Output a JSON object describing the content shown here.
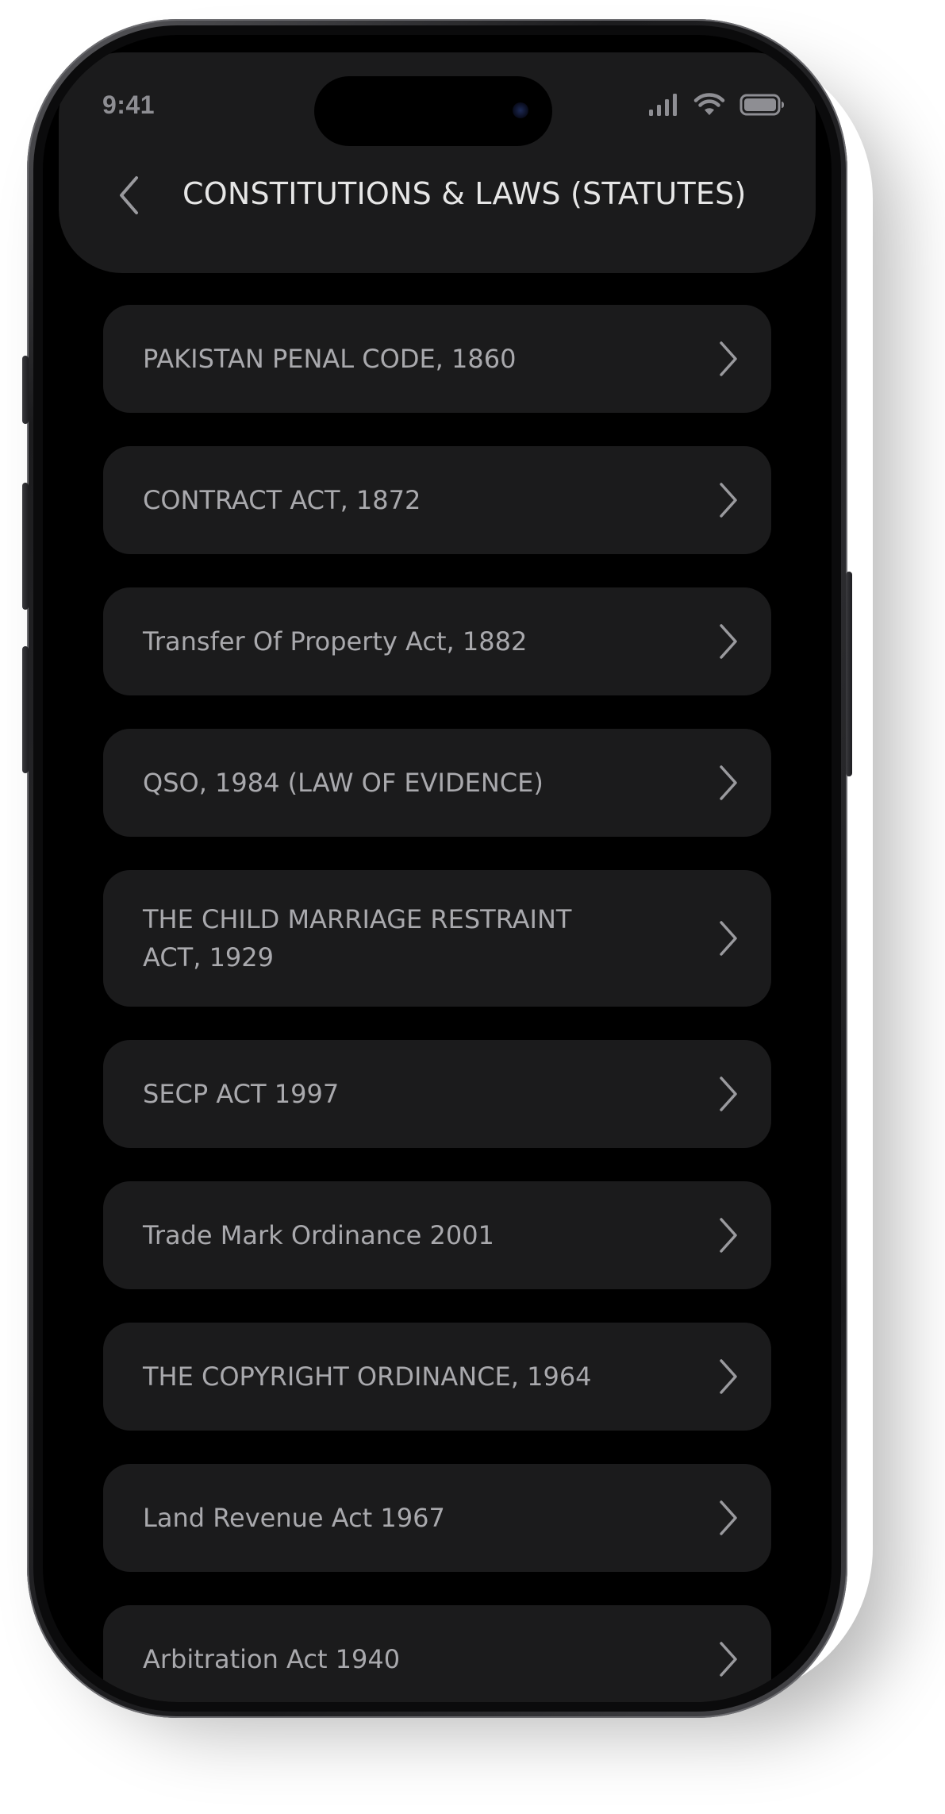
{
  "status_bar": {
    "time": "9:41",
    "icons": [
      "cellular-signal-icon",
      "wifi-icon",
      "battery-icon"
    ]
  },
  "header": {
    "title": "CONSTITUTIONS & LAWS (STATUTES)",
    "back_icon": "chevron-left-icon"
  },
  "list": {
    "items": [
      {
        "label": "PAKISTAN PENAL CODE, 1860"
      },
      {
        "label": "CONTRACT ACT, 1872"
      },
      {
        "label": "Transfer Of Property Act, 1882"
      },
      {
        "label": "QSO, 1984 (LAW OF EVIDENCE)"
      },
      {
        "label": "THE CHILD MARRIAGE RESTRAINT ACT, 1929"
      },
      {
        "label": "SECP ACT 1997"
      },
      {
        "label": "Trade Mark Ordinance 2001"
      },
      {
        "label": "THE COPYRIGHT ORDINANCE, 1964"
      },
      {
        "label": "Land Revenue Act 1967"
      },
      {
        "label": "Arbitration Act 1940"
      }
    ],
    "item_icon": "chevron-right-icon"
  },
  "colors": {
    "screen_background": "#000000",
    "card_background": "#1b1b1c",
    "title_text": "#e6e6e6",
    "item_text": "#a9a9ad",
    "icon": "#9a9a9e"
  }
}
